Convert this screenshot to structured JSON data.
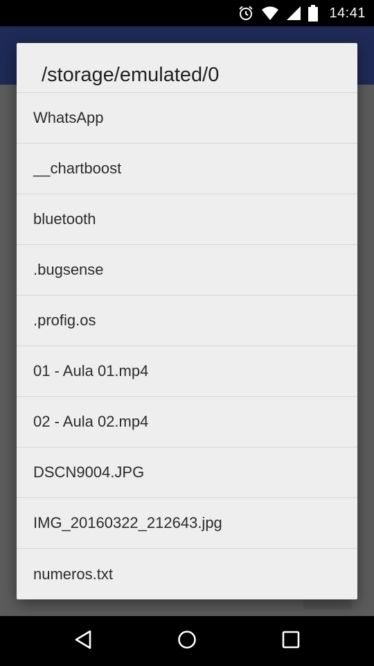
{
  "status_bar": {
    "time": "14:41",
    "icons": [
      "alarm-icon",
      "wifi-icon",
      "signal-icon",
      "battery-icon"
    ]
  },
  "dialog": {
    "title": "/storage/emulated/0",
    "items": [
      {
        "label": "WhatsApp"
      },
      {
        "label": "__chartboost"
      },
      {
        "label": "bluetooth"
      },
      {
        "label": ".bugsense"
      },
      {
        "label": ".profig.os"
      },
      {
        "label": "01 - Aula 01.mp4"
      },
      {
        "label": "02 - Aula 02.mp4"
      },
      {
        "label": "DSCN9004.JPG"
      },
      {
        "label": "IMG_20160322_212643.jpg"
      },
      {
        "label": "numeros.txt"
      }
    ]
  },
  "nav_bar": {
    "buttons": [
      "back-icon",
      "home-icon",
      "recents-icon"
    ]
  },
  "colors": {
    "app_bar": "#1f2a56",
    "dialog_bg": "#eeeeee",
    "scrim": "#5c5c5c",
    "divider": "#d6d6d6"
  }
}
